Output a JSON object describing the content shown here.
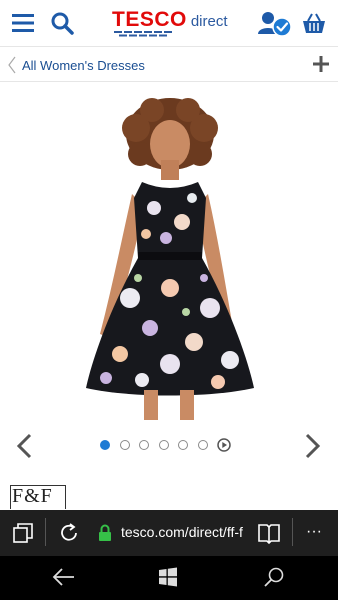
{
  "header": {
    "logo_brand": "TESCO",
    "logo_suffix": "direct",
    "brand_color": "#e10a0a",
    "accent_color": "#2c5aa0",
    "icons": [
      "menu-icon",
      "search-icon",
      "account-icon",
      "basket-icon"
    ]
  },
  "breadcrumb": {
    "label": "All Women's Dresses",
    "expand_icon": "plus-icon"
  },
  "product": {
    "image_icon": "floral-dress-image"
  },
  "carousel": {
    "total_dots": 6,
    "active_index": 0,
    "active_color": "#1e7bd4",
    "has_video": true
  },
  "brand": {
    "name": "F&F"
  },
  "browser": {
    "url": "tesco.com/direct/ff-f",
    "secure": true,
    "more_label": "···"
  },
  "system": {
    "icons": [
      "back-icon",
      "windows-icon",
      "search-icon"
    ]
  }
}
